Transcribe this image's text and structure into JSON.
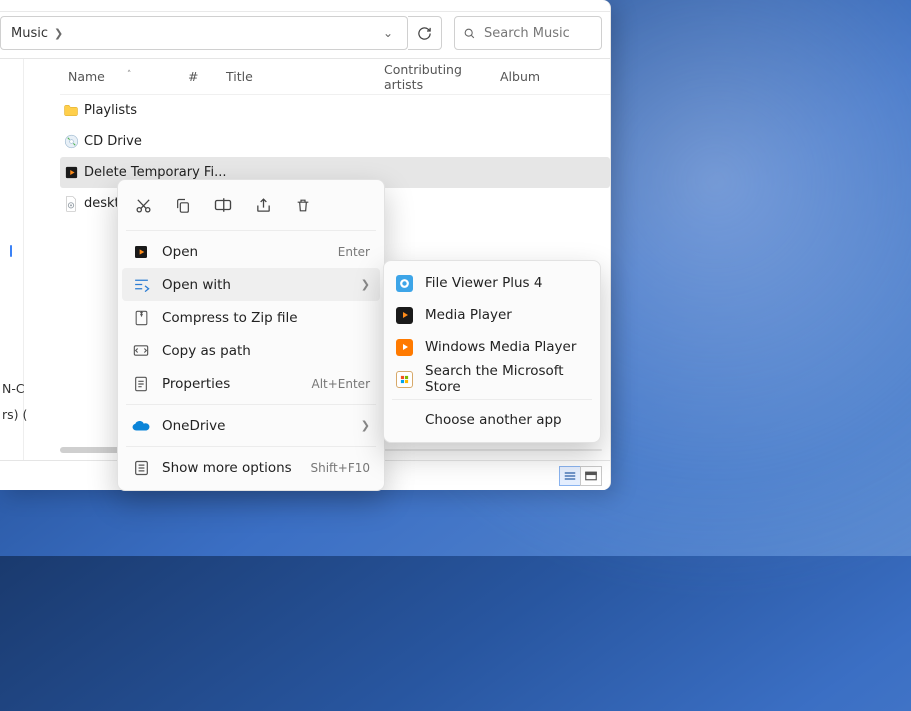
{
  "breadcrumb": {
    "folder": "Music"
  },
  "search": {
    "placeholder": "Search Music"
  },
  "columns": {
    "name": "Name",
    "num": "#",
    "title": "Title",
    "artist": "Contributing artists",
    "album": "Album"
  },
  "rows": {
    "playlists": "Playlists",
    "cddrive": "CD Drive",
    "deltemp": "Delete Temporary Fi...",
    "desktop": "deskto"
  },
  "clip": {
    "line1": "N-C",
    "line2": "rs) ("
  },
  "status": {
    "left": ""
  },
  "ctx": {
    "open": "Open",
    "open_accel": "Enter",
    "openwith": "Open with",
    "compress": "Compress to Zip file",
    "copypath": "Copy as path",
    "properties": "Properties",
    "properties_accel": "Alt+Enter",
    "onedrive": "OneDrive",
    "showmore": "Show more options",
    "showmore_accel": "Shift+F10"
  },
  "sub": {
    "fvp": "File Viewer Plus 4",
    "mp": "Media Player",
    "wmp": "Windows Media Player",
    "store": "Search the Microsoft Store",
    "choose": "Choose another app"
  }
}
